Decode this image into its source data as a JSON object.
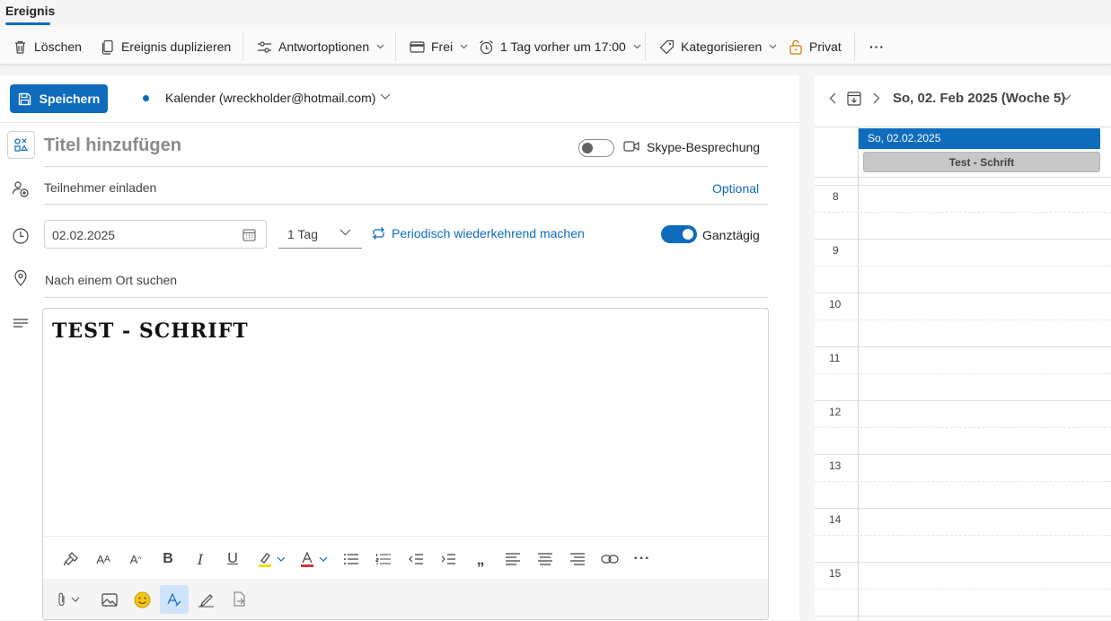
{
  "tab": {
    "label": "Ereignis"
  },
  "toolbar": {
    "delete": "Löschen",
    "duplicate": "Ereignis duplizieren",
    "response": "Antwortoptionen",
    "status": "Frei",
    "reminder": "1 Tag vorher um 17:00",
    "categorize": "Kategorisieren",
    "private": "Privat",
    "more": "···"
  },
  "form": {
    "save": "Speichern",
    "calendar": "Kalender (wreckholder@hotmail.com)",
    "title_placeholder": "Titel hinzufügen",
    "skype_label": "Skype-Besprechung",
    "skype_on": false,
    "invite_placeholder": "Teilnehmer einladen",
    "optional": "Optional",
    "date": "02.02.2025",
    "duration": "1 Tag",
    "recurring": "Periodisch wiederkehrend machen",
    "allday_label": "Ganztägig",
    "allday_on": true,
    "location_placeholder": "Nach einem Ort suchen",
    "body_text": "TEST - SCHRIFT"
  },
  "side": {
    "header_date": "So, 02. Feb 2025 (Woche 5)",
    "day_label": "So, 02.02.2025",
    "event_title": "Test - Schrift",
    "hours": [
      "8",
      "9",
      "10",
      "11",
      "12",
      "13",
      "14",
      "15"
    ]
  },
  "colors": {
    "accent": "#0f6cbd",
    "event_bg": "#c8c8c8"
  }
}
